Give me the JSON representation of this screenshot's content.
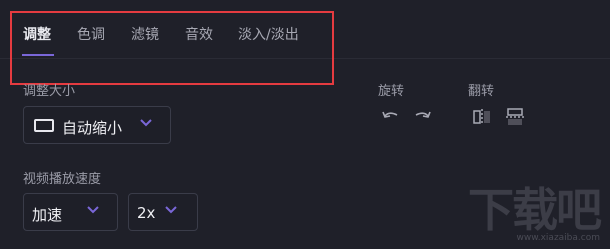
{
  "tabs": [
    {
      "label": "调整",
      "active": true
    },
    {
      "label": "色调",
      "active": false
    },
    {
      "label": "滤镜",
      "active": false
    },
    {
      "label": "音效",
      "active": false
    },
    {
      "label": "淡入/淡出",
      "active": false
    }
  ],
  "resize": {
    "label": "调整大小",
    "value": "自动缩小"
  },
  "rotate": {
    "label": "旋转",
    "icons": [
      "rotate-left-icon",
      "rotate-right-icon"
    ]
  },
  "flip": {
    "label": "翻转",
    "icons": [
      "flip-horizontal-icon",
      "flip-vertical-icon"
    ]
  },
  "speed": {
    "label": "视频播放速度",
    "mode_value": "加速",
    "rate_value": "2x"
  },
  "watermark": {
    "text": "下载吧",
    "url": "www.xiazaiba.com"
  },
  "colors": {
    "background": "#1f2029",
    "accent": "#7a67d8",
    "highlight_border": "#e53b40"
  }
}
